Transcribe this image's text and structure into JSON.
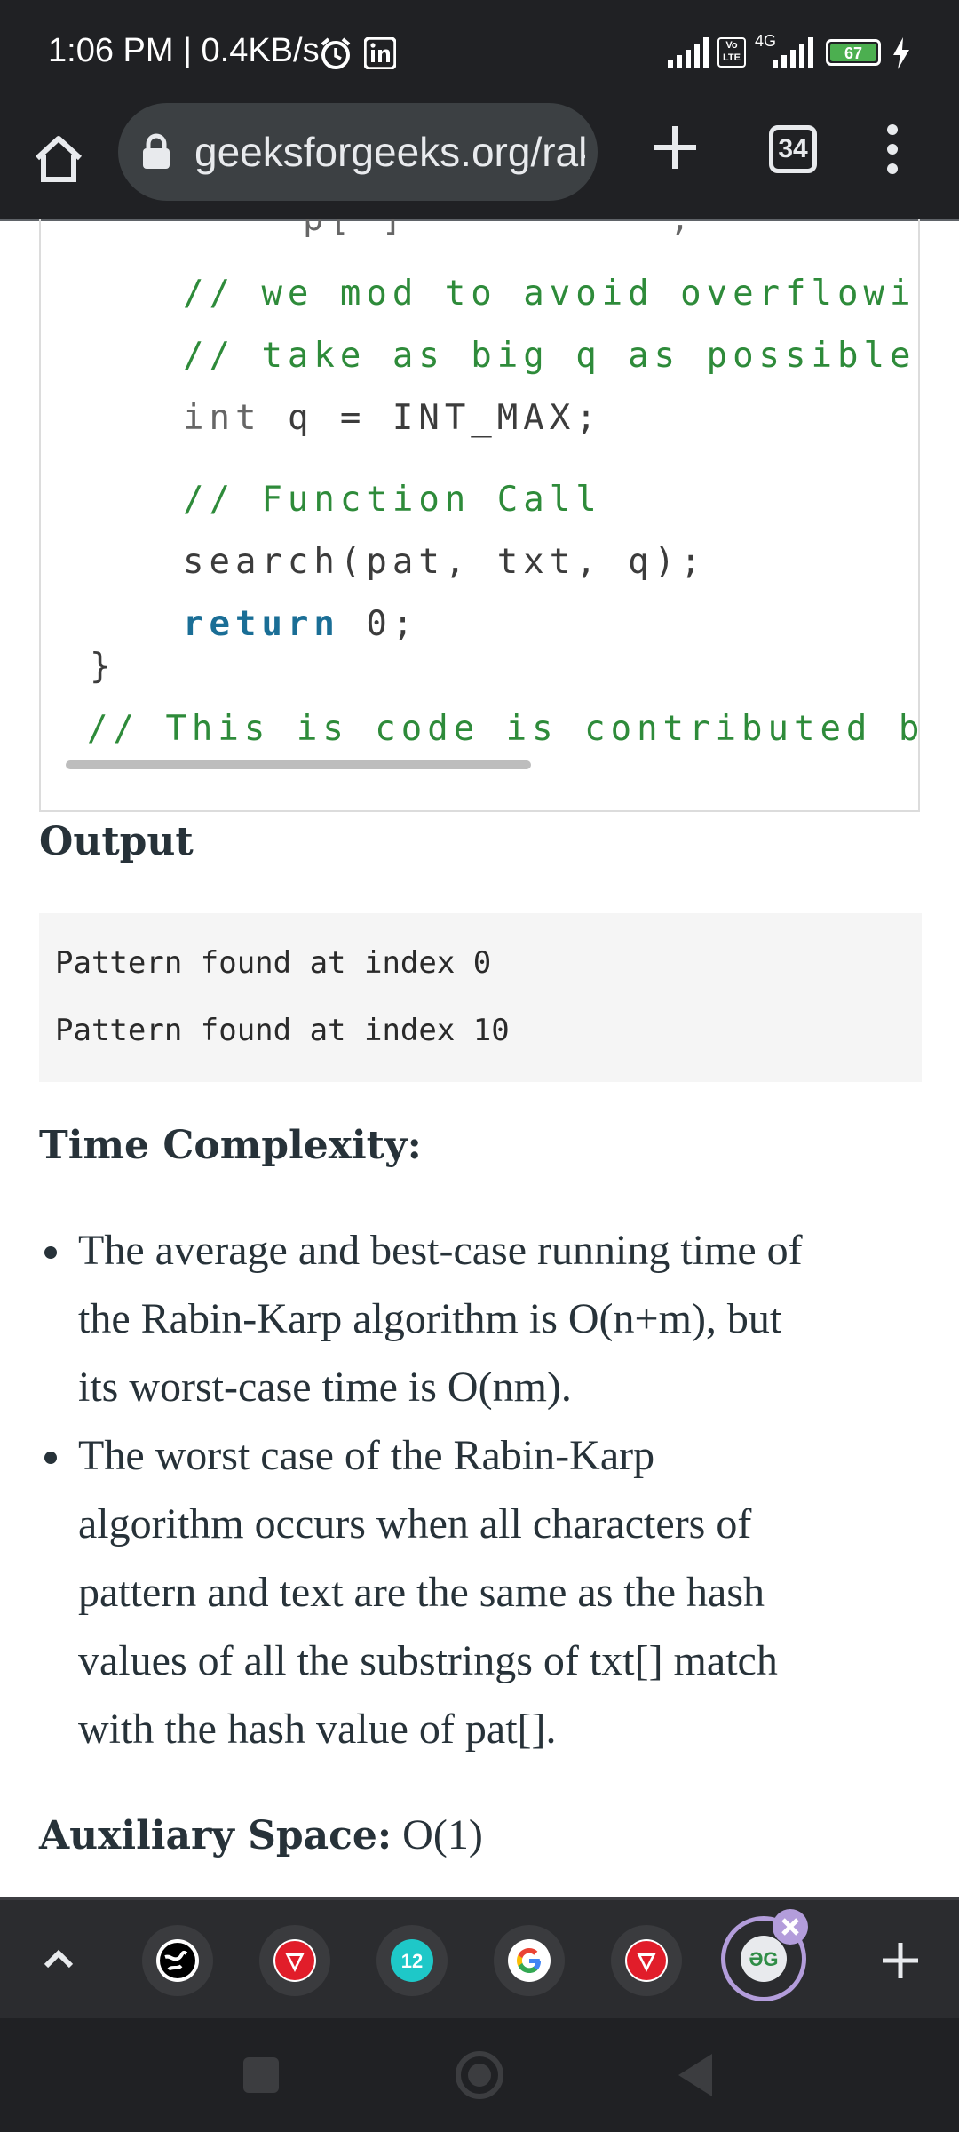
{
  "status_bar": {
    "time": "1:06 PM | 0.4KB/s",
    "network": "4G",
    "volte": "Vo LTE",
    "battery": "67"
  },
  "browser": {
    "url": "geeksforgeeks.org/rak",
    "tab_count": "34"
  },
  "code": {
    "lines": [
      "// we mod to avoid overflowing",
      "// take as big q as possible t",
      "q = INT_MAX;",
      "// Function Call",
      "search(pat, txt, q);",
      "0;",
      "}",
      "// This is code is contributed by"
    ],
    "kw_int": "int",
    "kw_return": "return"
  },
  "article": {
    "output_heading": "Output",
    "output_lines": [
      "Pattern found at index 0",
      "Pattern found at index 10"
    ],
    "time_heading": "Time Complexity:",
    "bullets": [
      [
        "The average and best-case running time of",
        "the Rabin-Karp algorithm is O(n+m), but",
        "its worst-case time is O(nm)."
      ],
      [
        "The worst case of the Rabin-Karp",
        "algorithm occurs when all characters of",
        "pattern and text are the same as the hash",
        "values of all the substrings of txt[] match",
        "with the hash value of pat[]."
      ]
    ],
    "aux_label": "Auxiliary Space:",
    "aux_value": " O(1)"
  },
  "tab_strip": {
    "tabs": [
      "globe-favicon",
      "tv-favicon",
      "12-favicon",
      "google-favicon",
      "tv-favicon",
      "gfg-favicon"
    ]
  }
}
